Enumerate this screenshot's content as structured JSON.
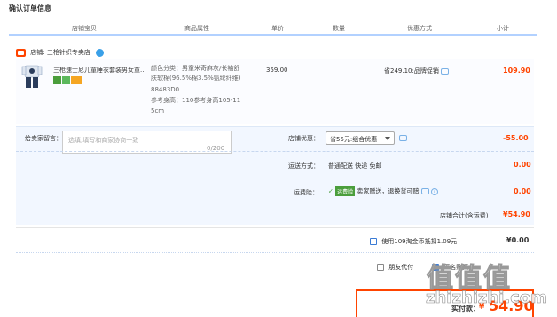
{
  "page": {
    "title": "确认订单信息"
  },
  "header": {
    "columns": [
      "店铺宝贝",
      "商品属性",
      "单价",
      "数量",
      "优惠方式",
      "小计"
    ]
  },
  "shop": {
    "label": "店铺:",
    "name": "三枪针织专卖店"
  },
  "item": {
    "name": "三枪速士尼儿童睡衣套装男女童...",
    "attr_color": "颜色分类：男童米奇麻灰/长袖舒",
    "attr_color_2": "肤软棉(96.5%棉3.5%氨纶纤维)",
    "attr_code": "88483D0",
    "attr_height": "参考身高：110参考身高105-11",
    "attr_height_2": "5cm",
    "price": "359.00",
    "discount": "省249.10:品牌促销",
    "subtotal": "109.90"
  },
  "memo": {
    "label": "给卖家留言：",
    "placeholder": "选填,填写和商家协商一致",
    "count": "0/200"
  },
  "shop_discount": {
    "label": "店铺优惠：",
    "selected": "省55元:组合优惠",
    "value": "-55.00"
  },
  "shipping": {
    "label": "运送方式：",
    "text": "普通配送 快递 免邮",
    "value": "0.00"
  },
  "insurance": {
    "label": "运费险：",
    "tag": "运费险",
    "text": "卖家赠送，退换货可赔",
    "value": "0.00"
  },
  "shop_total": {
    "label": "店铺合计(含运费)",
    "value": "¥54.90"
  },
  "coupon": {
    "label": "使用109淘金币抵扣1.09元",
    "value": "¥0.00"
  },
  "pay_options": {
    "friend_pay": "朋友代付",
    "anonymous": "匿名购买",
    "more": "..."
  },
  "final": {
    "label": "实付款：",
    "currency": "¥",
    "value": "54.90"
  },
  "watermark": {
    "text": "值值值",
    "url": "zhizhizhi.com"
  },
  "colors": {
    "accent": "#ff4400",
    "header_line": "#b2d1ff",
    "order_bg": "#f2f7ff",
    "link_blue": "#3a7bd5"
  }
}
